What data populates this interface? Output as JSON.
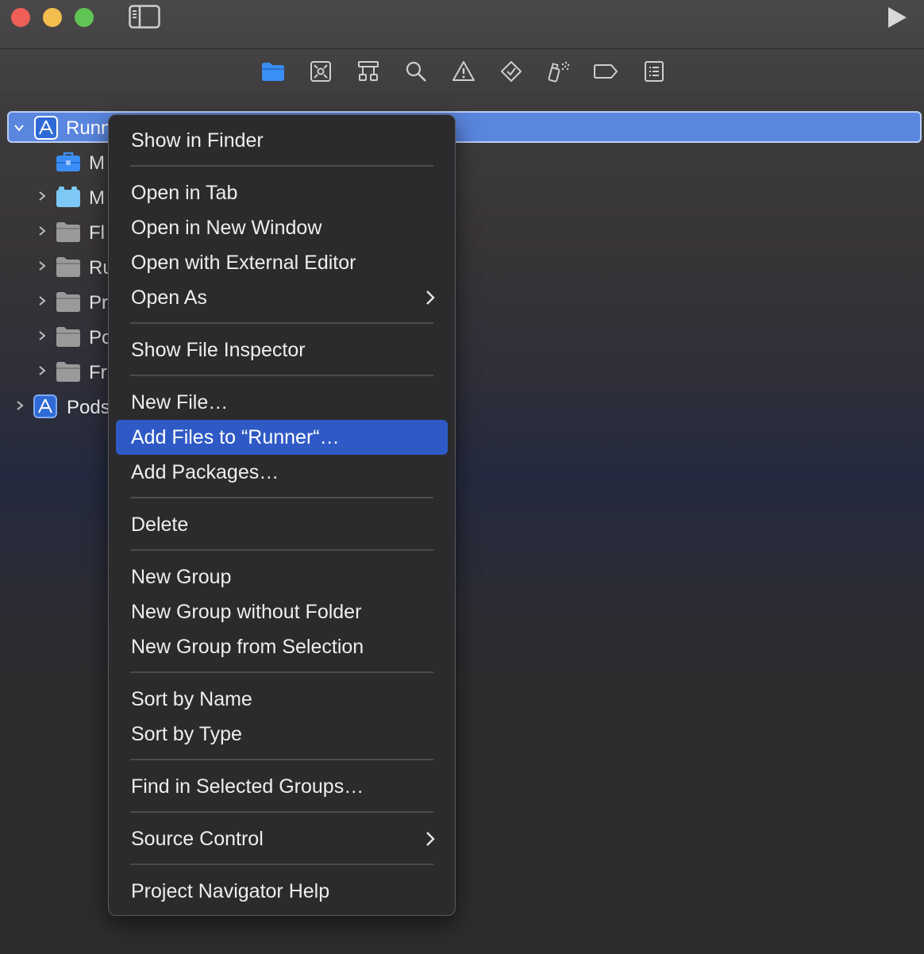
{
  "window": {
    "controls": [
      "close",
      "minimize",
      "zoom"
    ],
    "toolbar_icons": [
      "sidebar-toggle-icon",
      "run-icon"
    ]
  },
  "navigator_tabs": [
    {
      "icon": "folder-icon",
      "active": true
    },
    {
      "icon": "source-control-icon",
      "active": false
    },
    {
      "icon": "hierarchy-icon",
      "active": false
    },
    {
      "icon": "search-icon",
      "active": false
    },
    {
      "icon": "warning-icon",
      "active": false
    },
    {
      "icon": "test-diamond-icon",
      "active": false
    },
    {
      "icon": "debug-spray-icon",
      "active": false
    },
    {
      "icon": "breakpoint-tag-icon",
      "active": false
    },
    {
      "icon": "report-list-icon",
      "active": false
    }
  ],
  "tree": [
    {
      "label": "Runn",
      "icon": "xcode-project-icon",
      "expanded": true,
      "selected": true
    },
    {
      "label": "M",
      "icon": "toolbox-icon"
    },
    {
      "label": "M",
      "icon": "package-icon"
    },
    {
      "label": "Fl",
      "icon": "folder-icon"
    },
    {
      "label": "Ru",
      "icon": "folder-icon"
    },
    {
      "label": "Pr",
      "icon": "folder-icon"
    },
    {
      "label": "Po",
      "icon": "folder-icon"
    },
    {
      "label": "Fr",
      "icon": "folder-icon"
    },
    {
      "label": "Pods",
      "icon": "xcode-project-icon"
    }
  ],
  "context_menu": {
    "items": [
      {
        "label": "Show in Finder"
      },
      {
        "label": "Open in Tab"
      },
      {
        "label": "Open in New Window"
      },
      {
        "label": "Open with External Editor"
      },
      {
        "label": "Open As",
        "submenu": true
      },
      {
        "label": "Show File Inspector"
      },
      {
        "label": "New File…"
      },
      {
        "label": "Add Files to “Runner“…",
        "highlighted": true
      },
      {
        "label": "Add Packages…"
      },
      {
        "label": "Delete"
      },
      {
        "label": "New Group"
      },
      {
        "label": "New Group without Folder"
      },
      {
        "label": "New Group from Selection"
      },
      {
        "label": "Sort by Name"
      },
      {
        "label": "Sort by Type"
      },
      {
        "label": "Find in Selected Groups…"
      },
      {
        "label": "Source Control",
        "submenu": true
      },
      {
        "label": "Project Navigator Help"
      }
    ]
  },
  "colors": {
    "selection": "#5a86df",
    "menu_highlight": "#2f5ac6",
    "accent_folder": "#3a8ef5"
  }
}
